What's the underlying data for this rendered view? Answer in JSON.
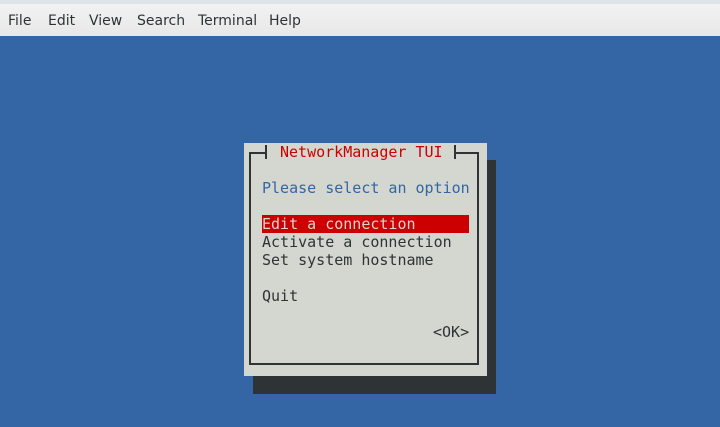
{
  "menubar": {
    "items": [
      "File",
      "Edit",
      "View",
      "Search",
      "Terminal",
      "Help"
    ]
  },
  "dialog": {
    "title": "NetworkManager TUI",
    "prompt": "Please select an option",
    "options": [
      "Edit a connection",
      "Activate a connection",
      "Set system hostname",
      "Quit"
    ],
    "selected_index": 0,
    "ok_button": "<OK>"
  },
  "colors": {
    "background": "#3465a4",
    "dialog": "#d3d7cf",
    "highlight": "#cc0000",
    "shadow": "#2e3436"
  }
}
